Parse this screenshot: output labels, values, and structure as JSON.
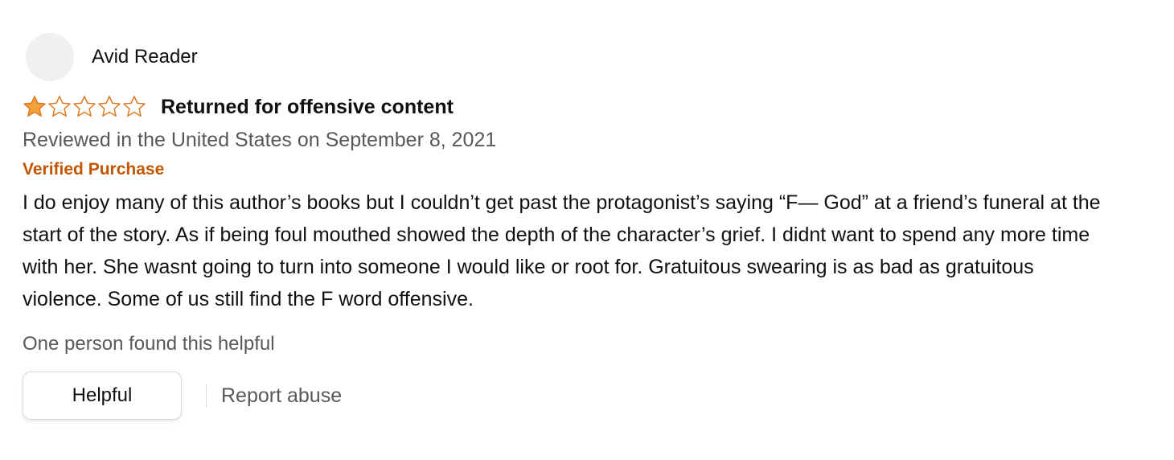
{
  "review": {
    "profile_name": "Avid Reader",
    "rating": 1,
    "rating_max": 5,
    "title": "Returned for offensive content",
    "date_text": "Reviewed in the United States on September 8, 2021",
    "verified_label": "Verified Purchase",
    "body": "I do enjoy many of this author’s books but I couldn’t get past the protagonist’s saying “F— God” at a friend’s funeral at the start of the story. As if being foul mouthed showed the depth of the character’s grief. I didnt want to spend any more time with her. She wasnt going to turn into someone I would like or root for. Gratuitous swearing is as bad as gratuitous violence. Some of us still find the F word offensive.",
    "helpful_count_text": "One person found this helpful",
    "helpful_label": "Helpful",
    "report_label": "Report abuse"
  },
  "colors": {
    "star_fill": "#f0a13a",
    "star_outline": "#de7921",
    "verified": "#c45500",
    "secondary_text": "#565959",
    "primary_text": "#0f1111"
  },
  "icons": {
    "avatar": "avatar-placeholder",
    "star_filled": "star-filled-icon",
    "star_empty": "star-outline-icon"
  }
}
